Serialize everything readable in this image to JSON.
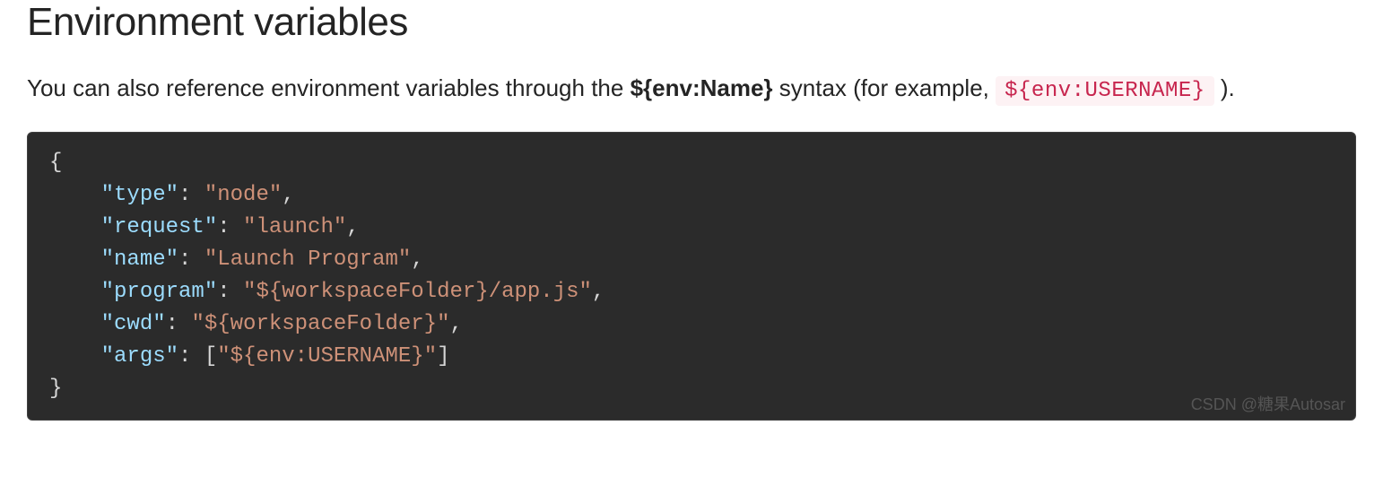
{
  "heading": "Environment variables",
  "description": {
    "pre": "You can also reference environment variables through the ",
    "bold": "${env:Name}",
    "mid": " syntax (for example, ",
    "code": "${env:USERNAME}",
    "post": " )."
  },
  "code": {
    "l1": "{",
    "l2_key": "\"type\"",
    "l2_val": "\"node\"",
    "l3_key": "\"request\"",
    "l3_val": "\"launch\"",
    "l4_key": "\"name\"",
    "l4_val": "\"Launch Program\"",
    "l5_key": "\"program\"",
    "l5_val": "\"${workspaceFolder}/app.js\"",
    "l6_key": "\"cwd\"",
    "l6_val": "\"${workspaceFolder}\"",
    "l7_key": "\"args\"",
    "l7_val": "\"${env:USERNAME}\"",
    "l8": "}"
  },
  "watermark": "CSDN @糖果Autosar"
}
